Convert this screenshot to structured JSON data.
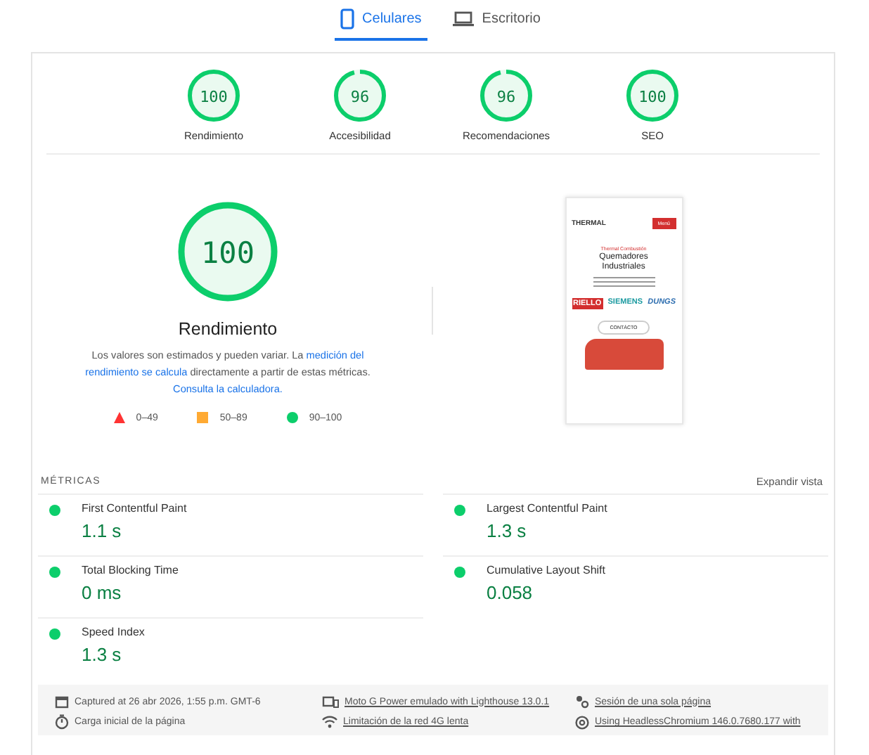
{
  "tabs": [
    {
      "label": "Celulares",
      "kind": "phone",
      "selected": true
    },
    {
      "label": "Escritorio",
      "kind": "laptop",
      "selected": false
    }
  ],
  "gauges": [
    {
      "score": "100",
      "label": "Rendimiento",
      "level": 1
    },
    {
      "score": "96",
      "label": "Accesibilidad",
      "level": 0.96
    },
    {
      "score": "96",
      "label": "Recomendaciones",
      "level": 0.96
    },
    {
      "score": "100",
      "label": "SEO",
      "level": 1
    }
  ],
  "main_gauge": {
    "score": "100",
    "label": "Rendimiento",
    "level": 1
  },
  "description": [
    {
      "kind": "text",
      "text": "Los valores son estimados y pueden variar. La "
    },
    {
      "kind": "link",
      "text": "medición del"
    },
    {
      "kind": "link",
      "text": "rendimiento se calcula"
    },
    {
      "kind": "text",
      "text": " directamente a partir de estas métricas. "
    },
    {
      "kind": "link",
      "text": "Consulta la calculadora."
    }
  ],
  "legend": [
    {
      "kind": "triangle",
      "label": "0–49",
      "color": "#ff3333"
    },
    {
      "kind": "square",
      "label": "50–89",
      "color": "#ffaa33"
    },
    {
      "kind": "circle",
      "label": "90–100",
      "color": "#0cce6b"
    }
  ],
  "screenshot": {
    "brand": "THERMAL",
    "button": "Menú",
    "eyebrow": "Thermal Combustión",
    "heading": "Quemadores Industriales",
    "logos": [
      "RIELLO",
      "SIEMENS",
      "DUNGS"
    ],
    "cta": "CONTÁCTO"
  },
  "metrics_title": "MÉTRICAS",
  "expand": "Expandir vista",
  "metrics": [
    {
      "name": "First Contentful Paint",
      "value": "1.1 s",
      "color": "#0cce6b"
    },
    {
      "name": "Largest Contentful Paint",
      "value": "1.3 s",
      "color": "#0cce6b"
    },
    {
      "name": "Total Blocking Time",
      "value": "0 ms",
      "color": "#0cce6b"
    },
    {
      "name": "Cumulative Layout Shift",
      "value": "0.058",
      "color": "#0cce6b"
    },
    {
      "name": "Speed Index",
      "value": "1.3 s",
      "color": "#0cce6b"
    }
  ],
  "footer": [
    {
      "kind": "calendar",
      "text": "Captured at 26 abr 2026, 1:55 p.m. GMT-6",
      "link": false
    },
    {
      "kind": "device",
      "text": "Moto G Power emulado with Lighthouse 13.0.1",
      "link": true
    },
    {
      "kind": "people",
      "text": "Sesión de una sola página",
      "link": true
    },
    {
      "kind": "timer",
      "text": "Carga inicial de la página",
      "link": false
    },
    {
      "kind": "wifi",
      "text": "Limitación de la red 4G lenta",
      "link": true
    },
    {
      "kind": "chrome",
      "text": "Using HeadlessChromium 146.0.7680.177 with",
      "link": true
    }
  ]
}
